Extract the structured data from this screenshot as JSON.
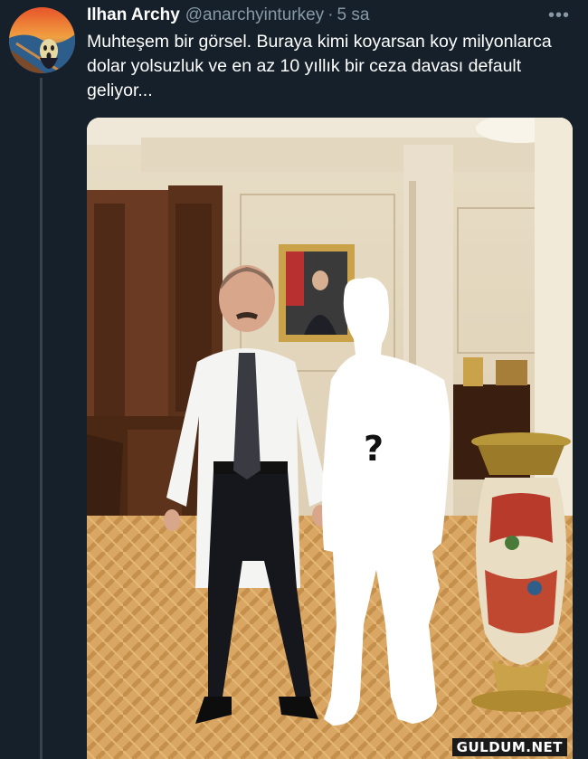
{
  "tweet": {
    "display_name": "Ilhan Archy",
    "handle": "@anarchyinturkey",
    "separator": "·",
    "time": "5 sa",
    "more_icon": "more-horizontal-icon",
    "text": "Muhteşem bir görsel. Buraya kimi koyarsan koy milyonlarca dolar yolsuzluk ve en az 10 yıllık bir ceza davası default geliyor..."
  },
  "image": {
    "question_mark": "?",
    "watermark": "GULDUM.NET"
  },
  "colors": {
    "background": "#15202b",
    "secondary_text": "#8899a6",
    "primary_text": "#ffffff"
  }
}
